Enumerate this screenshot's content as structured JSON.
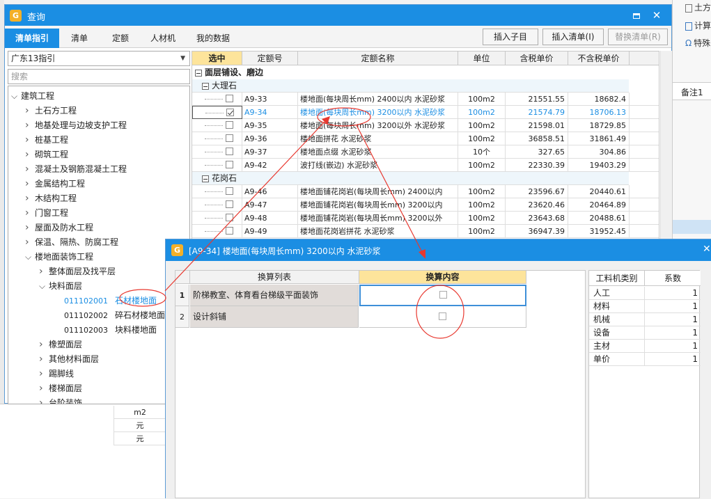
{
  "background": {
    "toolbar": [
      {
        "label": "土方",
        "icon": "page-icon"
      },
      {
        "label": "计算",
        "icon": "calculator-icon"
      },
      {
        "label": "特殊",
        "icon": "omega-icon"
      }
    ],
    "note_header": "备注1",
    "bottom_cells": [
      "m2",
      "元",
      "元"
    ]
  },
  "window": {
    "title": "查询",
    "tabs": [
      "清单指引",
      "清单",
      "定额",
      "人材机",
      "我的数据"
    ],
    "active_tab": 0,
    "buttons": {
      "insert_child": "插入子目",
      "insert_list": "插入清单(I)",
      "replace_list": "替换清单(R)"
    }
  },
  "left_panel": {
    "region": "广东13指引",
    "search_placeholder": "搜索",
    "tree": [
      {
        "level": 0,
        "label": "建筑工程",
        "state": "open"
      },
      {
        "level": 1,
        "label": "土石方工程",
        "state": "closed"
      },
      {
        "level": 1,
        "label": "地基处理与边坡支护工程",
        "state": "closed"
      },
      {
        "level": 1,
        "label": "桩基工程",
        "state": "closed"
      },
      {
        "level": 1,
        "label": "砌筑工程",
        "state": "closed"
      },
      {
        "level": 1,
        "label": "混凝土及钢筋混凝土工程",
        "state": "closed"
      },
      {
        "level": 1,
        "label": "金属结构工程",
        "state": "closed"
      },
      {
        "level": 1,
        "label": "木结构工程",
        "state": "closed"
      },
      {
        "level": 1,
        "label": "门窗工程",
        "state": "closed"
      },
      {
        "level": 1,
        "label": "屋面及防水工程",
        "state": "closed"
      },
      {
        "level": 1,
        "label": "保温、隔热、防腐工程",
        "state": "closed"
      },
      {
        "level": 1,
        "label": "楼地面装饰工程",
        "state": "open"
      },
      {
        "level": 2,
        "label": "整体面层及找平层",
        "state": "closed"
      },
      {
        "level": 2,
        "label": "块料面层",
        "state": "open"
      },
      {
        "level": 3,
        "code": "011102001",
        "label": "石材楼地面",
        "selected": true
      },
      {
        "level": 3,
        "code": "011102002",
        "label": "碎石材楼地面"
      },
      {
        "level": 3,
        "code": "011102003",
        "label": "块料楼地面"
      },
      {
        "level": 2,
        "label": "橡塑面层",
        "state": "closed"
      },
      {
        "level": 2,
        "label": "其他材料面层",
        "state": "closed"
      },
      {
        "level": 2,
        "label": "踢脚线",
        "state": "closed"
      },
      {
        "level": 2,
        "label": "楼梯面层",
        "state": "closed"
      },
      {
        "level": 2,
        "label": "台阶装饰",
        "state": "closed"
      }
    ]
  },
  "quota_grid": {
    "columns": [
      "选中",
      "定额号",
      "定额名称",
      "单位",
      "含税单价",
      "不含税单价"
    ],
    "section": "面层铺设、磨边",
    "groups": [
      {
        "name": "大理石",
        "rows": [
          {
            "checked": false,
            "code": "A9-33",
            "name": "楼地面(每块周长mm) 2400以内 水泥砂浆",
            "unit": "100m2",
            "tax_price": "21551.55",
            "net_price": "18682.4"
          },
          {
            "checked": true,
            "code": "A9-34",
            "name": "楼地面(每块周长mm) 3200以内 水泥砂浆",
            "unit": "100m2",
            "tax_price": "21574.79",
            "net_price": "18706.13",
            "selected": true
          },
          {
            "checked": false,
            "code": "A9-35",
            "name": "楼地面(每块周长mm) 3200以外 水泥砂浆",
            "unit": "100m2",
            "tax_price": "21598.01",
            "net_price": "18729.85"
          },
          {
            "checked": false,
            "code": "A9-36",
            "name": "楼地面拼花 水泥砂浆",
            "unit": "100m2",
            "tax_price": "36858.51",
            "net_price": "31861.49"
          },
          {
            "checked": false,
            "code": "A9-37",
            "name": "楼地面点缀 水泥砂浆",
            "unit": "10个",
            "tax_price": "327.65",
            "net_price": "304.86"
          },
          {
            "checked": false,
            "code": "A9-42",
            "name": "波打线(嵌边) 水泥砂浆",
            "unit": "100m2",
            "tax_price": "22330.39",
            "net_price": "19403.29"
          }
        ]
      },
      {
        "name": "花岗石",
        "rows": [
          {
            "checked": false,
            "code": "A9-46",
            "name": "楼地面铺花岗岩(每块周长mm) 2400以内",
            "unit": "100m2",
            "tax_price": "23596.67",
            "net_price": "20440.61"
          },
          {
            "checked": false,
            "code": "A9-47",
            "name": "楼地面铺花岗岩(每块周长mm) 3200以内",
            "unit": "100m2",
            "tax_price": "23620.46",
            "net_price": "20464.89"
          },
          {
            "checked": false,
            "code": "A9-48",
            "name": "楼地面铺花岗岩(每块周长mm) 3200以外",
            "unit": "100m2",
            "tax_price": "23643.68",
            "net_price": "20488.61"
          },
          {
            "checked": false,
            "code": "A9-49",
            "name": "楼地面花岗岩拼花 水泥砂浆",
            "unit": "100m2",
            "tax_price": "36947.39",
            "net_price": "31952.45"
          }
        ]
      }
    ]
  },
  "dialog": {
    "title": "[A9-34] 楼地面(每块周长mm) 3200以内 水泥砂浆",
    "conv_columns": [
      "换算列表",
      "换算内容"
    ],
    "conv_rows": [
      {
        "num": "1",
        "name": "阶梯教室、体育看台梯级平面装饰",
        "checked": false
      },
      {
        "num": "2",
        "name": "设计斜铺",
        "checked": false
      }
    ],
    "coef_columns": [
      "工料机类别",
      "系数"
    ],
    "coef_rows": [
      {
        "type": "人工",
        "value": "1"
      },
      {
        "type": "材料",
        "value": "1"
      },
      {
        "type": "机械",
        "value": "1"
      },
      {
        "type": "设备",
        "value": "1"
      },
      {
        "type": "主材",
        "value": "1"
      },
      {
        "type": "单价",
        "value": "1"
      }
    ]
  },
  "annotation_color": "#e8382f"
}
